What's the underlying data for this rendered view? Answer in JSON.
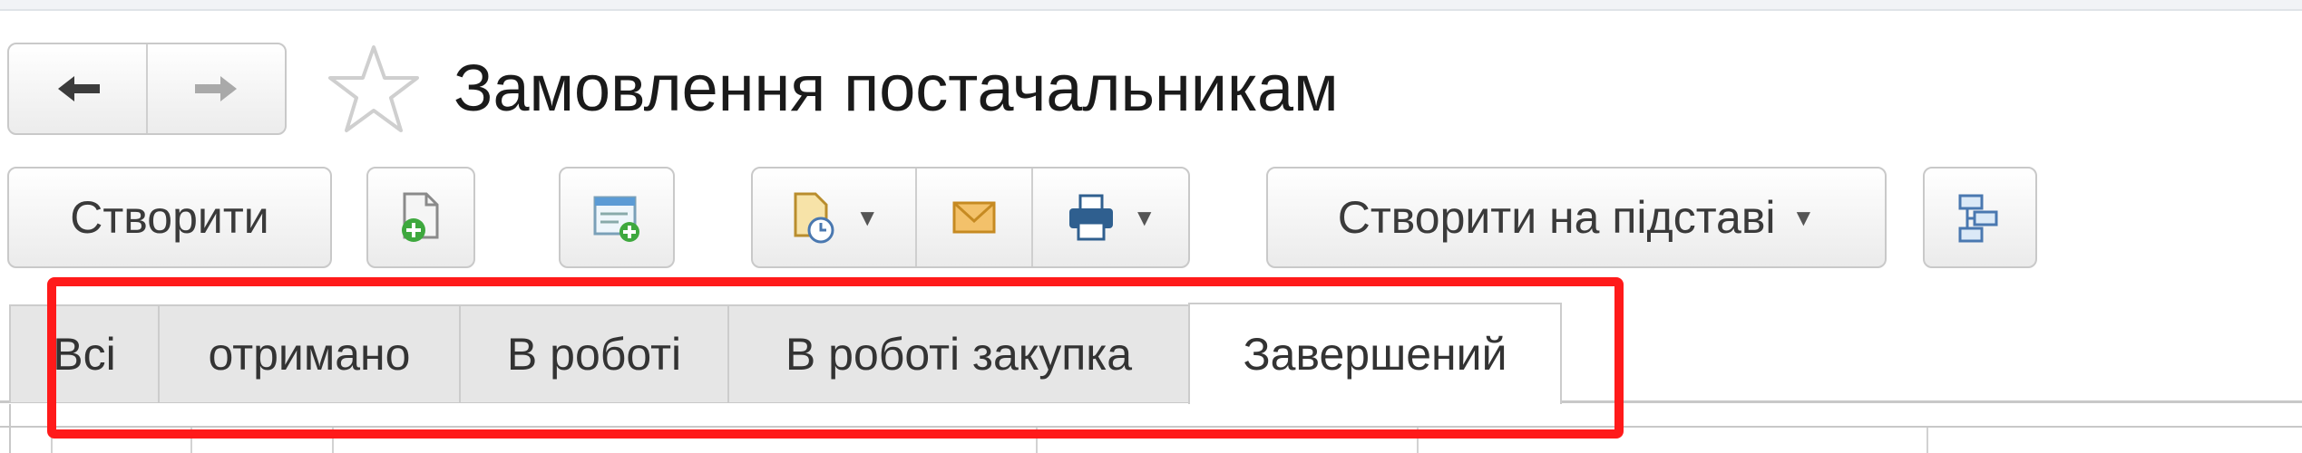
{
  "window": {
    "title": "Замовлення постачальникам"
  },
  "navigation": {
    "back_icon": "arrow-left-icon",
    "forward_icon": "arrow-right-icon",
    "favorite_icon": "star-icon"
  },
  "toolbar": {
    "create_label": "Створити",
    "create_based_label": "Створити на підставі",
    "icons": [
      "copy-document-icon",
      "add-list-icon",
      "report-clock-icon",
      "envelope-icon",
      "printer-icon",
      "structure-icon"
    ]
  },
  "tabs": [
    {
      "label": "Всі",
      "active": false
    },
    {
      "label": "отримано",
      "active": false
    },
    {
      "label": "В роботі",
      "active": false
    },
    {
      "label": "В роботі закупка",
      "active": false
    },
    {
      "label": "Завершений",
      "active": true
    }
  ],
  "colors": {
    "highlight": "#ff1a1a",
    "accent_green": "#3ea83e",
    "accent_orange": "#e8a23a"
  }
}
